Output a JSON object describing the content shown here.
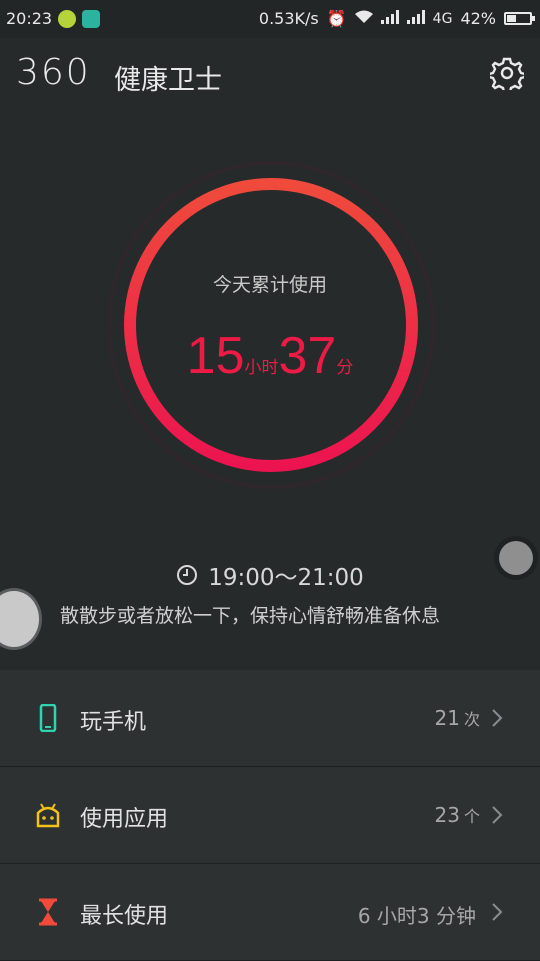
{
  "status_bar": {
    "time": "20:23",
    "network_speed": "0.53K/s",
    "network_type": "4G",
    "battery": "42%",
    "battery_level": 0.42
  },
  "header": {
    "logo_number": "360",
    "app_title": "健康卫士",
    "settings_icon": "gear-icon"
  },
  "usage": {
    "label": "今天累计使用",
    "hours": "15",
    "hours_unit": "小时",
    "minutes": "37",
    "minutes_unit": "分",
    "ring_color": "#ec1b46"
  },
  "schedule": {
    "icon": "clock-icon",
    "time_range": "19:00～21:00",
    "tip": "散散步或者放松一下，保持心情舒畅准备休息"
  },
  "stats": [
    {
      "icon": "phone-icon",
      "color": "#2fd3b0",
      "label": "玩手机",
      "value": "21",
      "unit": "次"
    },
    {
      "icon": "android-icon",
      "color": "#f2c21b",
      "label": "使用应用",
      "value": "23",
      "unit": "个"
    },
    {
      "icon": "hourglass-icon",
      "color": "#f04b3a",
      "label": "最长使用",
      "value": "6 小时3 分钟",
      "unit": ""
    }
  ]
}
